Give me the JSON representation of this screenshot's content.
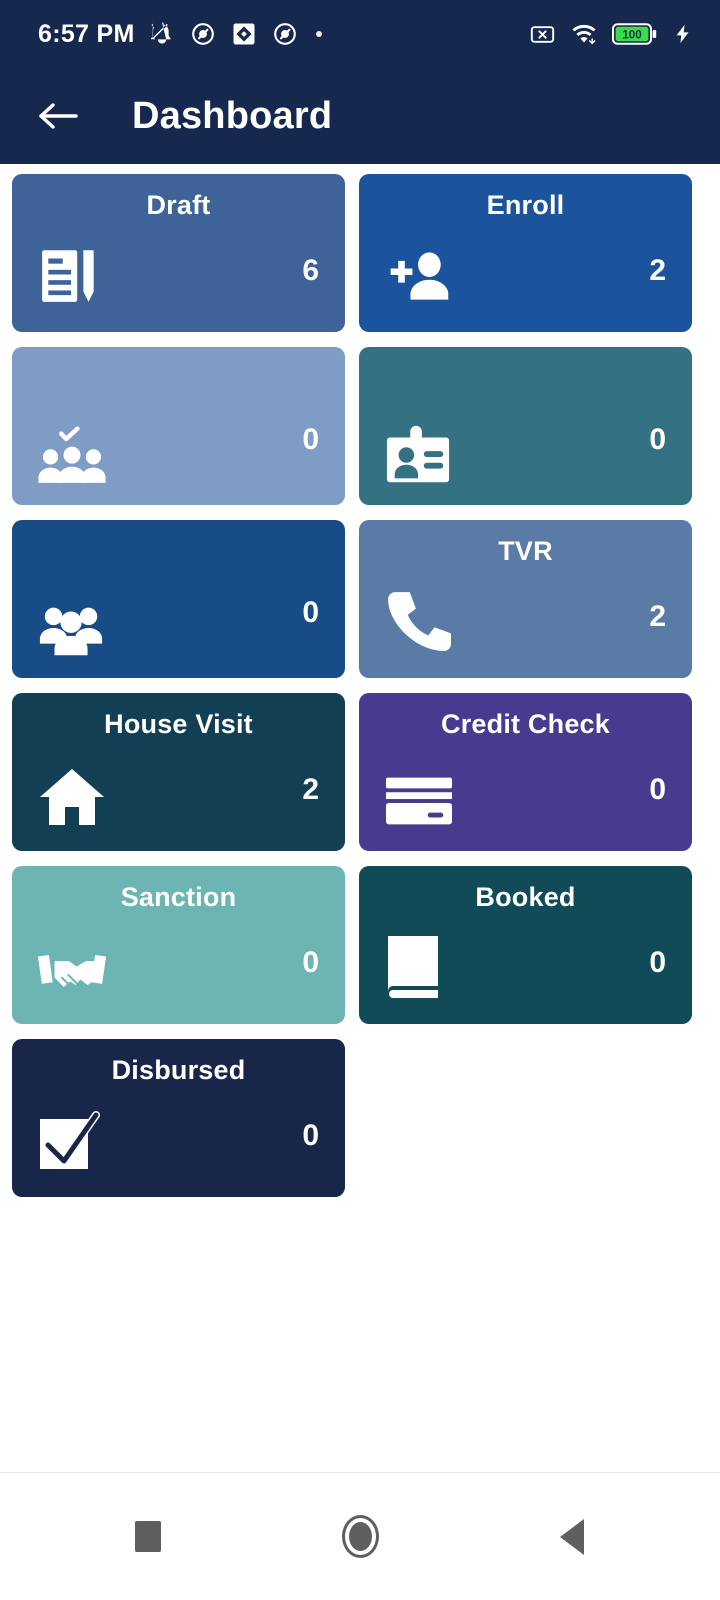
{
  "statusbar": {
    "time": "6:57 PM",
    "left_icons": [
      "bell-off-icon",
      "app-circle-icon",
      "diamond-app-icon",
      "app-circle-icon",
      "dot-icon"
    ],
    "right_icons": [
      "no-sim-icon",
      "wifi-icon",
      "battery-icon",
      "charging-bolt-icon"
    ],
    "battery_level": "100"
  },
  "appbar": {
    "back_icon": "arrow-left-icon",
    "title": "Dashboard",
    "background": "#16284d"
  },
  "cards": [
    {
      "label": "Draft",
      "count": "6",
      "color": "#3d6398",
      "icon": "document-pencil-icon"
    },
    {
      "label": "Enroll",
      "count": "2",
      "color": "#1b539c",
      "icon": "person-add-icon"
    },
    {
      "label": "",
      "count": "0",
      "color": "#7e9cc4",
      "icon": "group-check-icon"
    },
    {
      "label": "",
      "count": "0",
      "color": "#347183",
      "icon": "id-badge-icon"
    },
    {
      "label": "",
      "count": "0",
      "color": "#174c86",
      "icon": "group-people-icon"
    },
    {
      "label": "TVR",
      "count": "2",
      "color": "#5a7ba6",
      "icon": "phone-icon"
    },
    {
      "label": "House Visit",
      "count": "2",
      "color": "#133f55",
      "icon": "home-icon"
    },
    {
      "label": "Credit Check",
      "count": "0",
      "color": "#473b8f",
      "icon": "credit-card-icon"
    },
    {
      "label": "Sanction",
      "count": "0",
      "color": "#6db5b3",
      "icon": "handshake-icon"
    },
    {
      "label": "Booked",
      "count": "0",
      "color": "#124b58",
      "icon": "book-icon"
    },
    {
      "label": "Disbursed",
      "count": "0",
      "color": "#18264a",
      "icon": "checkbox-check-icon"
    }
  ],
  "navbar": {
    "recents_label": "recents-square",
    "home_label": "home-circle",
    "back_label": "back-triangle"
  }
}
